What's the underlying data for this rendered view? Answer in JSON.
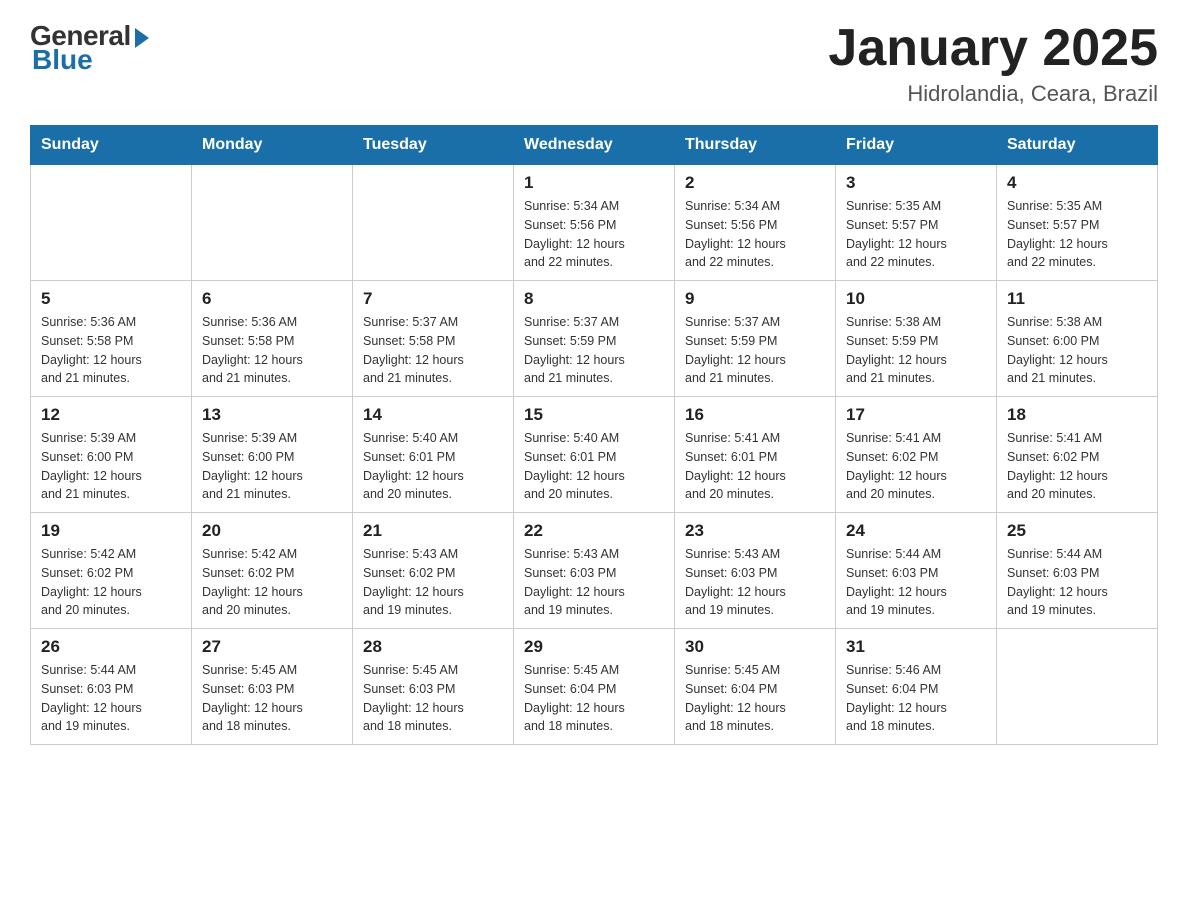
{
  "header": {
    "logo": {
      "general": "General",
      "blue": "Blue"
    },
    "title": "January 2025",
    "location": "Hidrolandia, Ceara, Brazil"
  },
  "days_of_week": [
    "Sunday",
    "Monday",
    "Tuesday",
    "Wednesday",
    "Thursday",
    "Friday",
    "Saturday"
  ],
  "weeks": [
    [
      {
        "day": "",
        "info": ""
      },
      {
        "day": "",
        "info": ""
      },
      {
        "day": "",
        "info": ""
      },
      {
        "day": "1",
        "info": "Sunrise: 5:34 AM\nSunset: 5:56 PM\nDaylight: 12 hours\nand 22 minutes."
      },
      {
        "day": "2",
        "info": "Sunrise: 5:34 AM\nSunset: 5:56 PM\nDaylight: 12 hours\nand 22 minutes."
      },
      {
        "day": "3",
        "info": "Sunrise: 5:35 AM\nSunset: 5:57 PM\nDaylight: 12 hours\nand 22 minutes."
      },
      {
        "day": "4",
        "info": "Sunrise: 5:35 AM\nSunset: 5:57 PM\nDaylight: 12 hours\nand 22 minutes."
      }
    ],
    [
      {
        "day": "5",
        "info": "Sunrise: 5:36 AM\nSunset: 5:58 PM\nDaylight: 12 hours\nand 21 minutes."
      },
      {
        "day": "6",
        "info": "Sunrise: 5:36 AM\nSunset: 5:58 PM\nDaylight: 12 hours\nand 21 minutes."
      },
      {
        "day": "7",
        "info": "Sunrise: 5:37 AM\nSunset: 5:58 PM\nDaylight: 12 hours\nand 21 minutes."
      },
      {
        "day": "8",
        "info": "Sunrise: 5:37 AM\nSunset: 5:59 PM\nDaylight: 12 hours\nand 21 minutes."
      },
      {
        "day": "9",
        "info": "Sunrise: 5:37 AM\nSunset: 5:59 PM\nDaylight: 12 hours\nand 21 minutes."
      },
      {
        "day": "10",
        "info": "Sunrise: 5:38 AM\nSunset: 5:59 PM\nDaylight: 12 hours\nand 21 minutes."
      },
      {
        "day": "11",
        "info": "Sunrise: 5:38 AM\nSunset: 6:00 PM\nDaylight: 12 hours\nand 21 minutes."
      }
    ],
    [
      {
        "day": "12",
        "info": "Sunrise: 5:39 AM\nSunset: 6:00 PM\nDaylight: 12 hours\nand 21 minutes."
      },
      {
        "day": "13",
        "info": "Sunrise: 5:39 AM\nSunset: 6:00 PM\nDaylight: 12 hours\nand 21 minutes."
      },
      {
        "day": "14",
        "info": "Sunrise: 5:40 AM\nSunset: 6:01 PM\nDaylight: 12 hours\nand 20 minutes."
      },
      {
        "day": "15",
        "info": "Sunrise: 5:40 AM\nSunset: 6:01 PM\nDaylight: 12 hours\nand 20 minutes."
      },
      {
        "day": "16",
        "info": "Sunrise: 5:41 AM\nSunset: 6:01 PM\nDaylight: 12 hours\nand 20 minutes."
      },
      {
        "day": "17",
        "info": "Sunrise: 5:41 AM\nSunset: 6:02 PM\nDaylight: 12 hours\nand 20 minutes."
      },
      {
        "day": "18",
        "info": "Sunrise: 5:41 AM\nSunset: 6:02 PM\nDaylight: 12 hours\nand 20 minutes."
      }
    ],
    [
      {
        "day": "19",
        "info": "Sunrise: 5:42 AM\nSunset: 6:02 PM\nDaylight: 12 hours\nand 20 minutes."
      },
      {
        "day": "20",
        "info": "Sunrise: 5:42 AM\nSunset: 6:02 PM\nDaylight: 12 hours\nand 20 minutes."
      },
      {
        "day": "21",
        "info": "Sunrise: 5:43 AM\nSunset: 6:02 PM\nDaylight: 12 hours\nand 19 minutes."
      },
      {
        "day": "22",
        "info": "Sunrise: 5:43 AM\nSunset: 6:03 PM\nDaylight: 12 hours\nand 19 minutes."
      },
      {
        "day": "23",
        "info": "Sunrise: 5:43 AM\nSunset: 6:03 PM\nDaylight: 12 hours\nand 19 minutes."
      },
      {
        "day": "24",
        "info": "Sunrise: 5:44 AM\nSunset: 6:03 PM\nDaylight: 12 hours\nand 19 minutes."
      },
      {
        "day": "25",
        "info": "Sunrise: 5:44 AM\nSunset: 6:03 PM\nDaylight: 12 hours\nand 19 minutes."
      }
    ],
    [
      {
        "day": "26",
        "info": "Sunrise: 5:44 AM\nSunset: 6:03 PM\nDaylight: 12 hours\nand 19 minutes."
      },
      {
        "day": "27",
        "info": "Sunrise: 5:45 AM\nSunset: 6:03 PM\nDaylight: 12 hours\nand 18 minutes."
      },
      {
        "day": "28",
        "info": "Sunrise: 5:45 AM\nSunset: 6:03 PM\nDaylight: 12 hours\nand 18 minutes."
      },
      {
        "day": "29",
        "info": "Sunrise: 5:45 AM\nSunset: 6:04 PM\nDaylight: 12 hours\nand 18 minutes."
      },
      {
        "day": "30",
        "info": "Sunrise: 5:45 AM\nSunset: 6:04 PM\nDaylight: 12 hours\nand 18 minutes."
      },
      {
        "day": "31",
        "info": "Sunrise: 5:46 AM\nSunset: 6:04 PM\nDaylight: 12 hours\nand 18 minutes."
      },
      {
        "day": "",
        "info": ""
      }
    ]
  ]
}
